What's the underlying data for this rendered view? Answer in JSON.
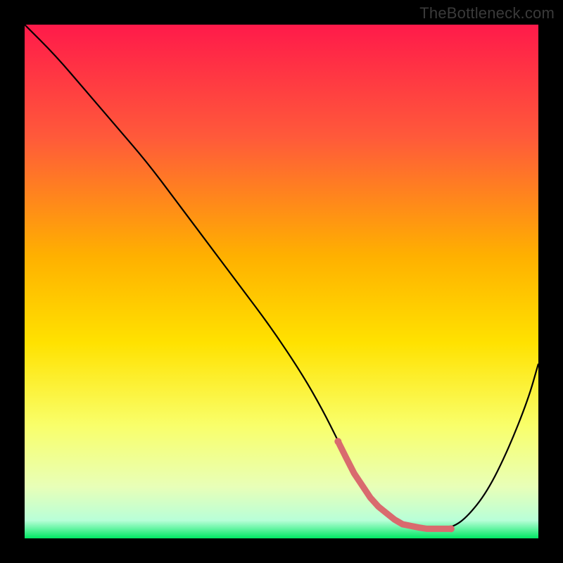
{
  "watermark": "TheBottleneck.com",
  "colors": {
    "top": "#ff1a4a",
    "mid_upper": "#ff6a3a",
    "mid": "#ffd400",
    "mid_lower": "#f7ff66",
    "near_bottom": "#d3ffb0",
    "bottom": "#00e864",
    "curve": "#000000",
    "band": "#d96a6e",
    "band_dot": "#d96a6e",
    "bg": "#000000"
  },
  "gradient_stops": [
    {
      "offset": 0,
      "color": "#ff1a4a"
    },
    {
      "offset": 0.22,
      "color": "#ff5a3a"
    },
    {
      "offset": 0.45,
      "color": "#ffb000"
    },
    {
      "offset": 0.62,
      "color": "#ffe200"
    },
    {
      "offset": 0.78,
      "color": "#f9ff6a"
    },
    {
      "offset": 0.9,
      "color": "#e8ffb8"
    },
    {
      "offset": 0.965,
      "color": "#b8ffd8"
    },
    {
      "offset": 1.0,
      "color": "#00e864"
    }
  ],
  "chart_data": {
    "type": "line",
    "title": "",
    "xlabel": "",
    "ylabel": "",
    "xlim": [
      0,
      100
    ],
    "ylim": [
      0,
      100
    ],
    "series": [
      {
        "name": "curve",
        "x": [
          0,
          6,
          12,
          18,
          24,
          30,
          36,
          42,
          48,
          54,
          58,
          61,
          64,
          68,
          73,
          78,
          80,
          83,
          86,
          90,
          94,
          98,
          100
        ],
        "values": [
          100,
          94,
          87,
          80,
          73,
          65,
          57,
          49,
          41,
          32,
          25,
          19,
          13,
          7,
          3,
          2,
          2,
          2,
          4,
          9,
          17,
          27,
          34
        ]
      }
    ],
    "optimal_band": {
      "x_start": 61,
      "x_end": 83,
      "y_level": 2,
      "endpoint_radius_px": 5
    },
    "annotations": [
      "TheBottleneck.com"
    ]
  }
}
